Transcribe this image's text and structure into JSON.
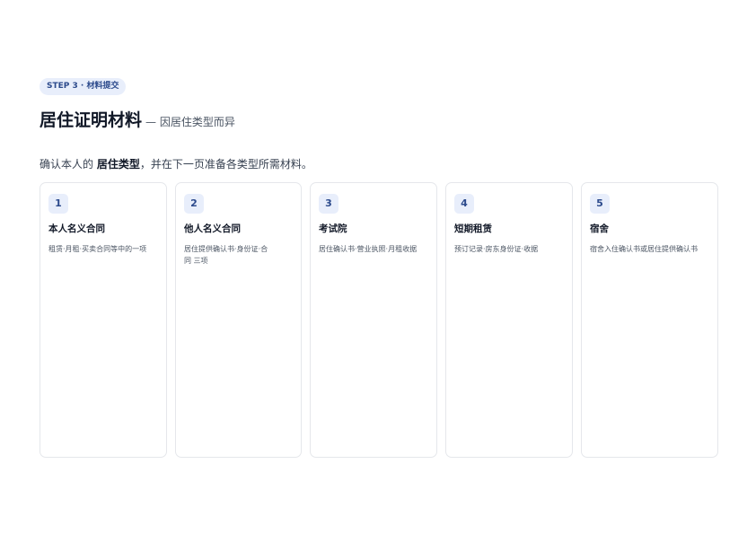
{
  "step_badge": "STEP 3 · 材料提交",
  "title": {
    "main": "居住证明材料",
    "sub": "— 因居住类型而异"
  },
  "intro": {
    "prefix": "确认本人的 ",
    "bold": "居住类型",
    "suffix": "，并在下一页准备各类型所需材料。"
  },
  "cards": [
    {
      "number": "1",
      "title": "本人名义合同",
      "desc": "租赁·月租·买卖合同等中的一项"
    },
    {
      "number": "2",
      "title": "他人名义合同",
      "desc": "居住提供确认书·身份证·合同 三项"
    },
    {
      "number": "3",
      "title": "考试院",
      "desc": "居住确认书·营业执照·月租收据"
    },
    {
      "number": "4",
      "title": "短期租赁",
      "desc": "预订记录·房东身份证·收据"
    },
    {
      "number": "5",
      "title": "宿舍",
      "desc": "宿舍入住确认书或居住提供确认书"
    }
  ],
  "colors": {
    "accent": "#2c4a8c",
    "badge_bg": "#e8eefb",
    "border": "#e5e7eb"
  }
}
